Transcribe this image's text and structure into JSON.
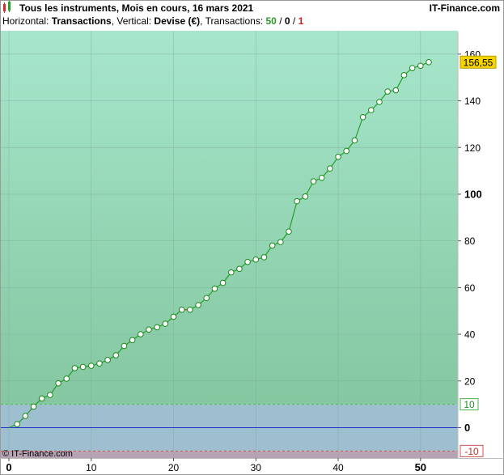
{
  "header": {
    "title": "Tous les instruments, Mois en cours, 16 mars 2021",
    "brand": "IT-Finance.com",
    "subtitle": {
      "horizontal_label": "Horizontal: ",
      "horizontal_value": "Transactions",
      "vertical_label": ", Vertical: ",
      "vertical_value": "Devise (€)",
      "transactions_label": ", Transactions: ",
      "count_total": "50",
      "sep1": " / ",
      "count_neutral": "0",
      "sep2": " / ",
      "count_negative": "1"
    }
  },
  "footer": {
    "copyright": "© IT-Finance.com"
  },
  "colors": {
    "line": "#1e9a1e",
    "negative_segment": "#cc2222",
    "marker_stroke": "#1a8a1a",
    "upper_zone_top": "#a7e6cc",
    "upper_zone_bottom": "#84c7a0",
    "mid_zone": "#9ebfcf",
    "lower_zone": "#b8a3b4",
    "zero_line": "#2233cc",
    "last_value_badge": "#f5d400",
    "count_total": "#2a9a2a",
    "count_negative": "#cc2222"
  },
  "chart_data": {
    "type": "line",
    "xlim": [
      0,
      51
    ],
    "ylim": [
      -13,
      170
    ],
    "x_ticks": [
      0,
      10,
      20,
      30,
      40,
      50
    ],
    "y_ticks": [
      0,
      20,
      40,
      60,
      80,
      100,
      120,
      140,
      160
    ],
    "thresholds": {
      "upper": 10,
      "lower": -10,
      "upper_label": "10",
      "lower_label": "-10"
    },
    "last_value": "156,55",
    "series": [
      {
        "x": [
          0,
          1,
          2,
          3,
          4,
          5,
          6,
          7,
          8,
          9,
          10,
          11,
          12,
          13,
          14,
          15,
          16,
          17,
          18,
          19,
          20,
          21,
          22,
          23,
          24,
          25,
          26,
          27,
          28,
          29,
          30,
          31,
          32,
          33,
          34,
          35,
          36,
          37,
          38,
          39,
          40,
          41,
          42,
          43,
          44,
          45,
          46,
          47,
          48,
          49,
          50,
          51
        ],
        "y": [
          0,
          1.5,
          5,
          9,
          12.5,
          14,
          19,
          21,
          25.5,
          26,
          26.5,
          27.5,
          29,
          31,
          35,
          37.5,
          40,
          42,
          43,
          44.5,
          47.5,
          50.5,
          50.5,
          52.5,
          55.5,
          59.5,
          62,
          66.5,
          68,
          71,
          72,
          73,
          78,
          79.5,
          84,
          97,
          99,
          105.5,
          107,
          111,
          116,
          118.5,
          123,
          133,
          136,
          139.5,
          144,
          144.5,
          151,
          154,
          155,
          156.55
        ],
        "negative_segments": [
          21
        ]
      }
    ]
  }
}
